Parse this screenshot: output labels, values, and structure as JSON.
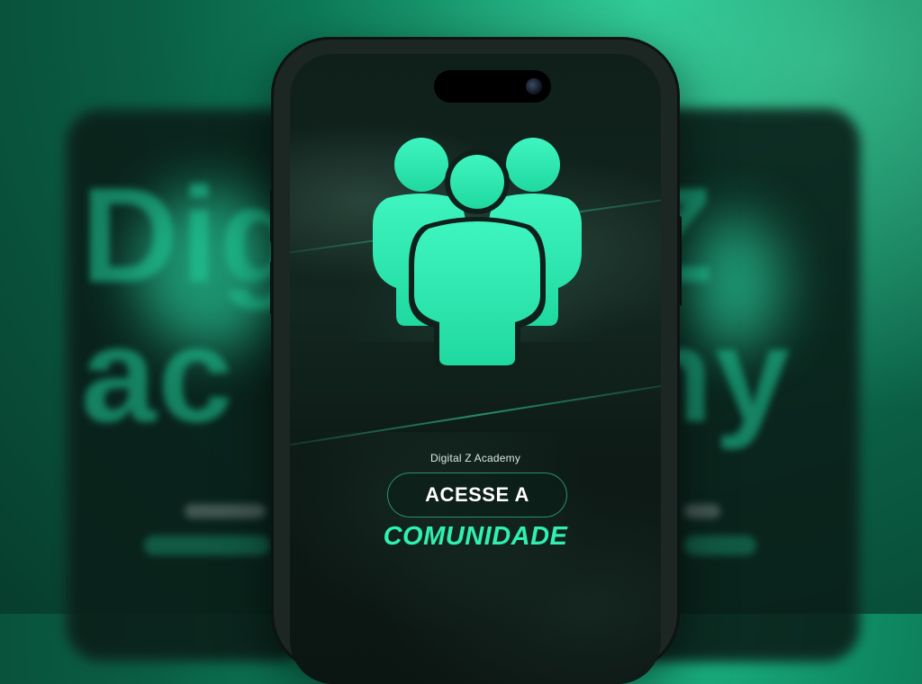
{
  "background": {
    "blurred_words": [
      "Dig",
      "ac",
      "Z",
      "ny"
    ]
  },
  "phone": {
    "brand": "Digital Z Academy",
    "cta_label": "ACESSE A",
    "headline": "COMUNIDADE",
    "icon": "community-users-icon"
  },
  "colors": {
    "accent": "#2ff0b0",
    "background": "#0f8a62",
    "screen": "#0f1f1a"
  }
}
